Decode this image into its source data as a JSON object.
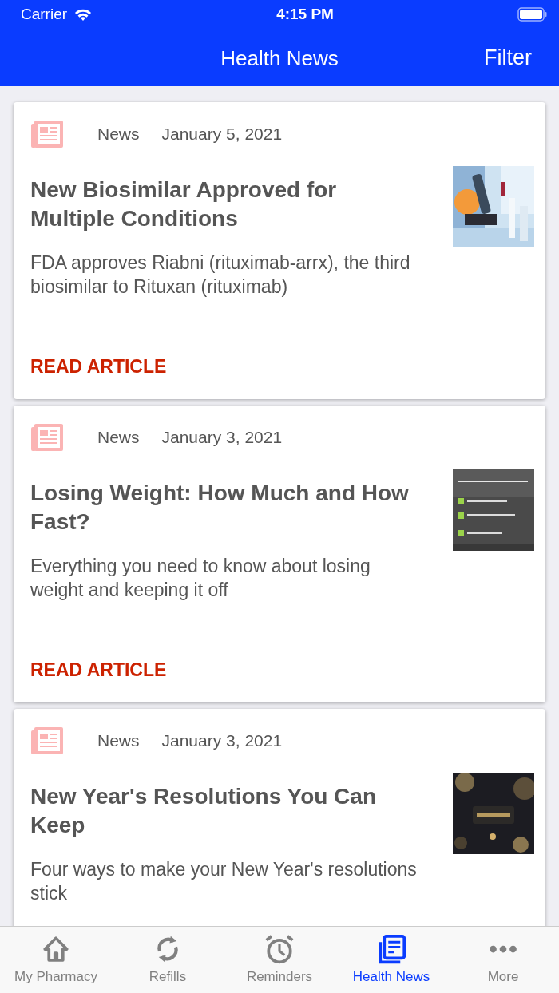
{
  "status_bar": {
    "carrier": "Carrier",
    "time": "4:15 PM"
  },
  "nav_bar": {
    "title": "Health News",
    "action": "Filter"
  },
  "articles": [
    {
      "category": "News",
      "date": "January 5, 2021",
      "title": "New Biosimilar Approved for Multiple Conditions",
      "summary": "FDA approves Riabni (rituximab-arrx), the third biosimilar to Rituxan (rituximab)",
      "link": "READ ARTICLE"
    },
    {
      "category": "News",
      "date": "January 3, 2021",
      "title": "Losing Weight: How Much and How Fast?",
      "summary": "Everything you need to know about losing weight and keeping it off",
      "link": "READ ARTICLE"
    },
    {
      "category": "News",
      "date": "January 3, 2021",
      "title": "New Year's Resolutions You Can Keep",
      "summary": "Four ways to make your New Year's resolutions stick"
    }
  ],
  "tab_bar": [
    {
      "label": "My Pharmacy",
      "kind": "home",
      "selected": false
    },
    {
      "label": "Refills",
      "kind": "refresh",
      "selected": false
    },
    {
      "label": "Reminders",
      "kind": "clock",
      "selected": false
    },
    {
      "label": "Health News",
      "kind": "news",
      "selected": true
    },
    {
      "label": "More",
      "kind": "more",
      "selected": false
    }
  ]
}
